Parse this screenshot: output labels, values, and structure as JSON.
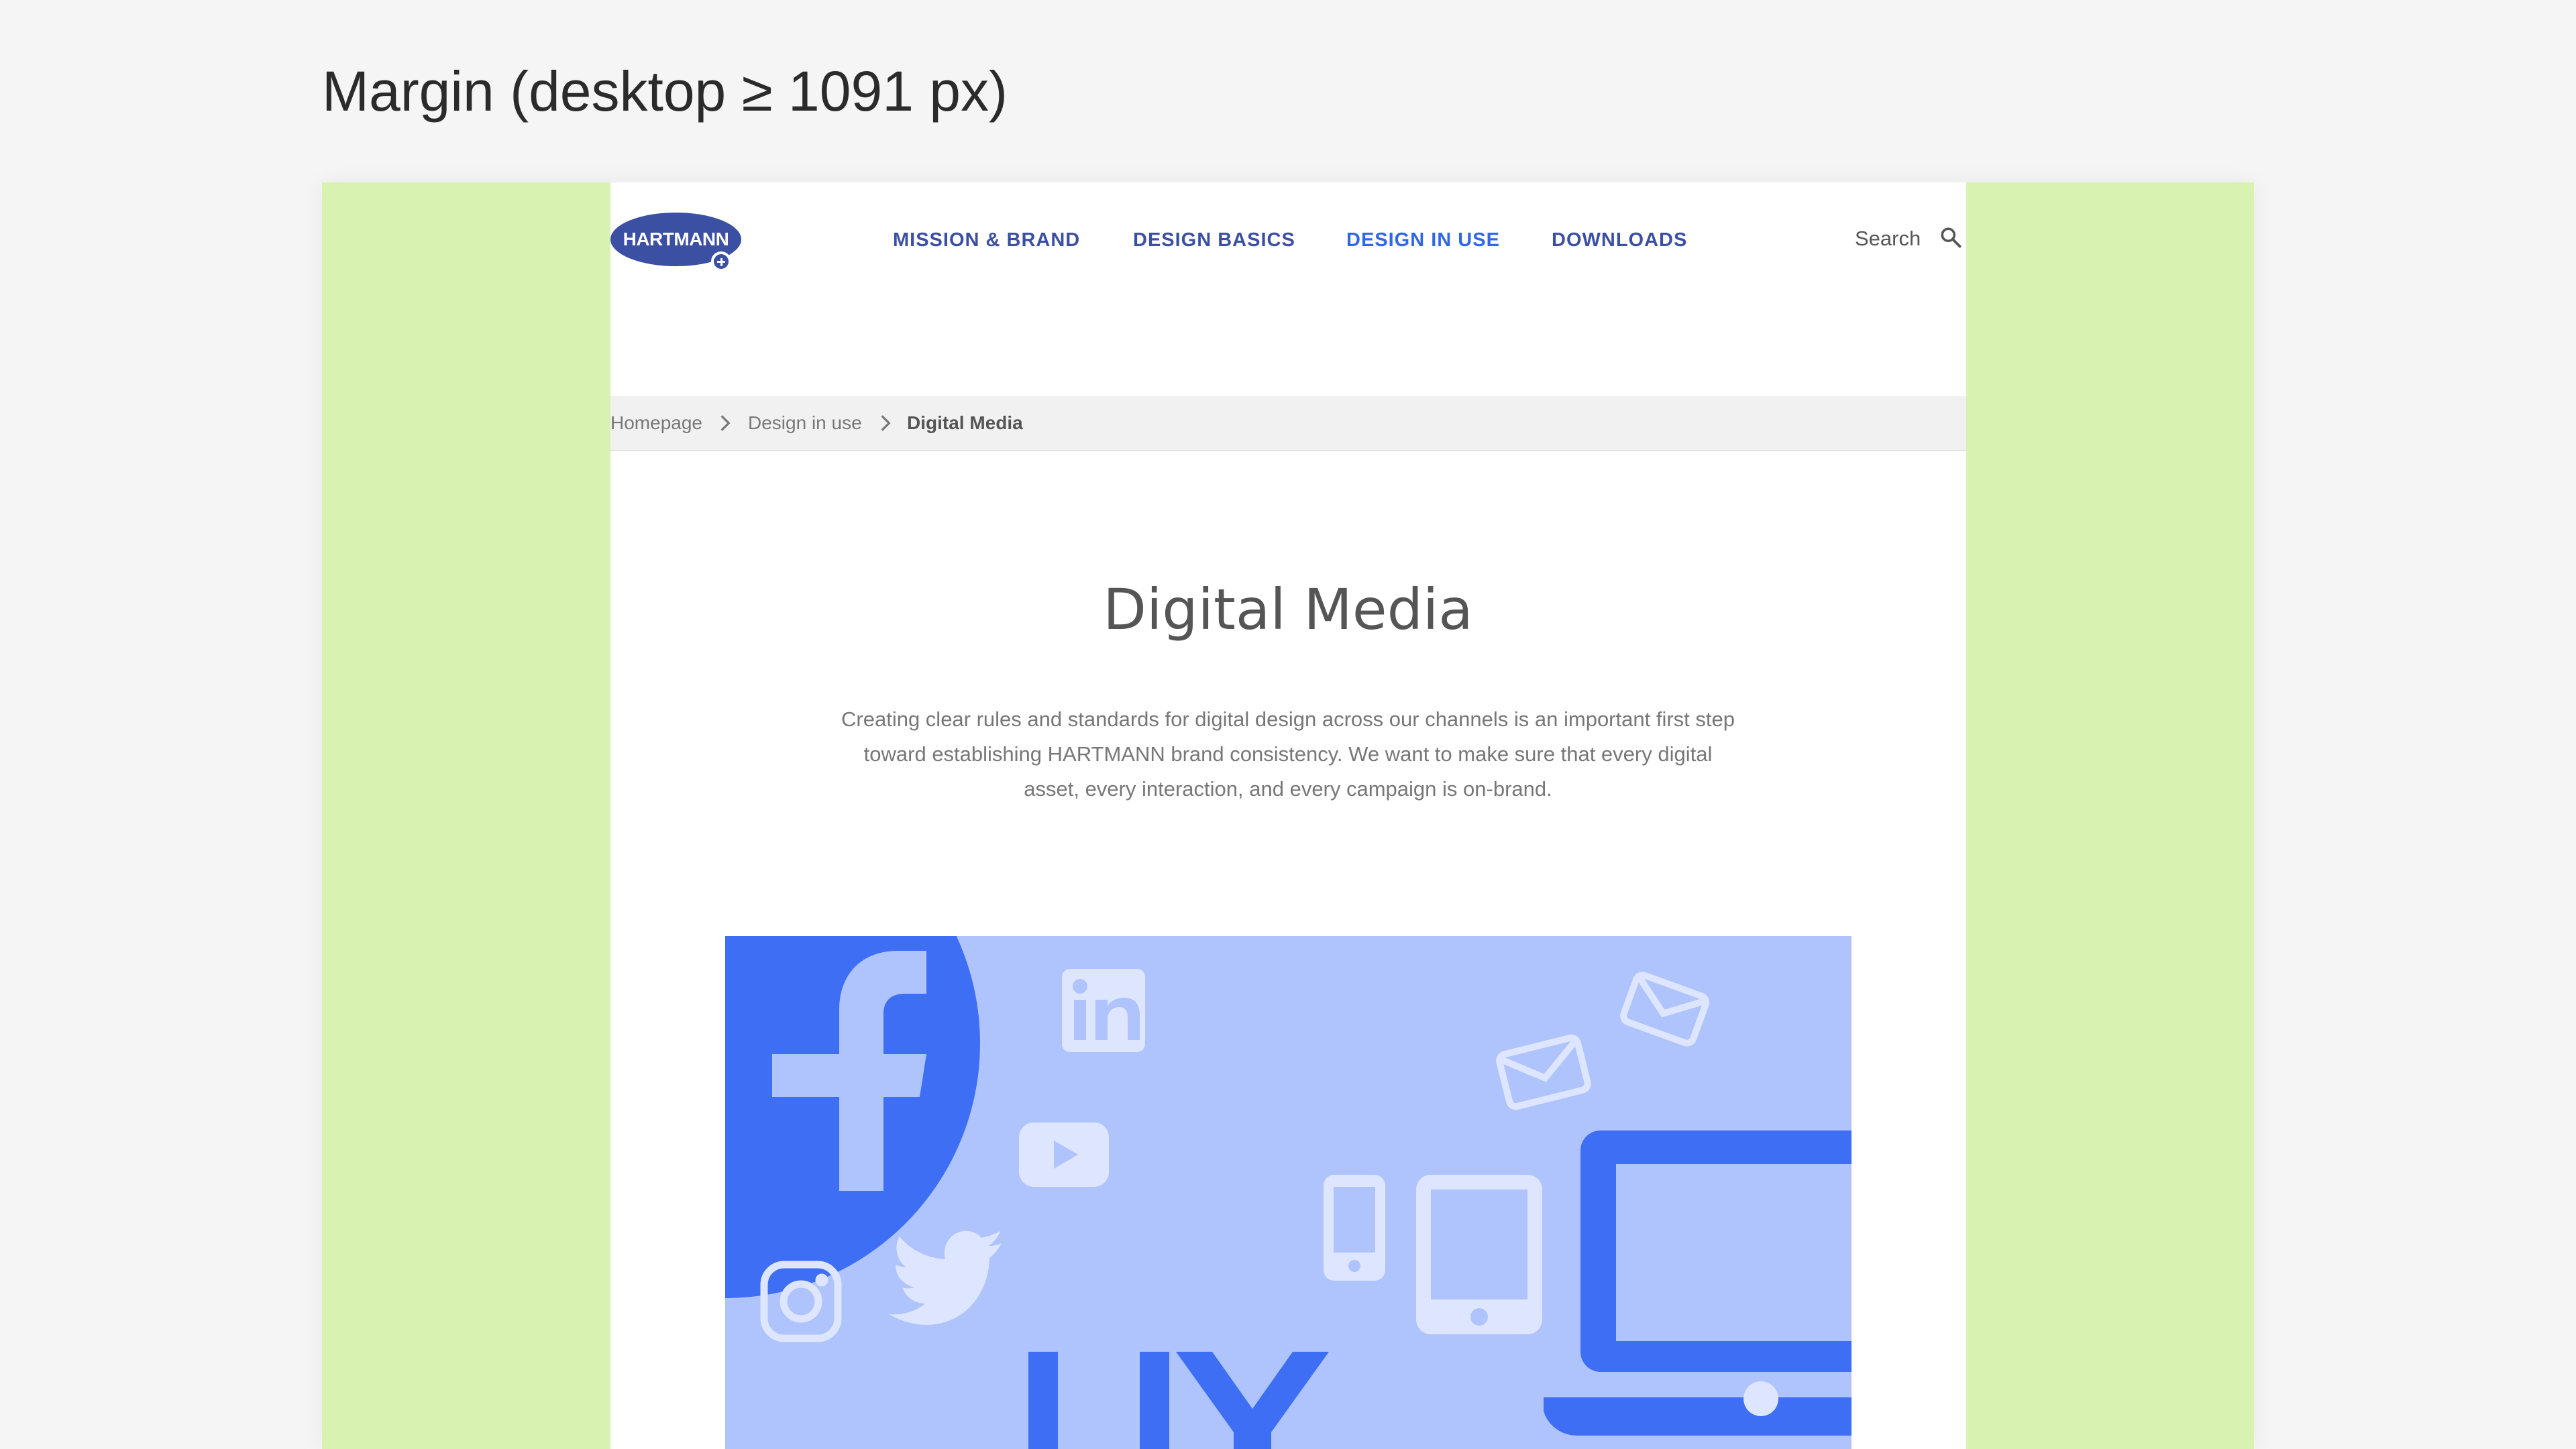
{
  "doc_title": "Margin (desktop ≥ 1091 px)",
  "colors": {
    "margin_overlay": "#d6f1ae",
    "brand_blue": "#3b4fa3",
    "active_blue": "#2f67e6",
    "hero_bg": "#afc3fd",
    "icon_blue": "#3d6ef4"
  },
  "site": {
    "logo_text": "HARTMANN",
    "nav": [
      {
        "label": "MISSION & BRAND"
      },
      {
        "label": "DESIGN BASICS"
      },
      {
        "label": "DESIGN IN USE",
        "active": true
      },
      {
        "label": "DOWNLOADS"
      }
    ],
    "search_label": "Search",
    "breadcrumb": [
      "Homepage",
      "Design in use",
      "Digital Media"
    ],
    "page_title": "Digital Media",
    "intro": "Creating clear rules and standards for digital design across our channels is an important first step toward establishing HARTMANN brand consistency. We want to make sure that every digital asset, every interaction, and every campaign is on-brand.",
    "hero_icons": [
      "facebook-icon",
      "linkedin-icon",
      "youtube-icon",
      "instagram-icon",
      "twitter-icon",
      "email-icon",
      "mobile-phone-icon",
      "tablet-icon",
      "laptop-icon"
    ],
    "hero_text": "UX"
  }
}
